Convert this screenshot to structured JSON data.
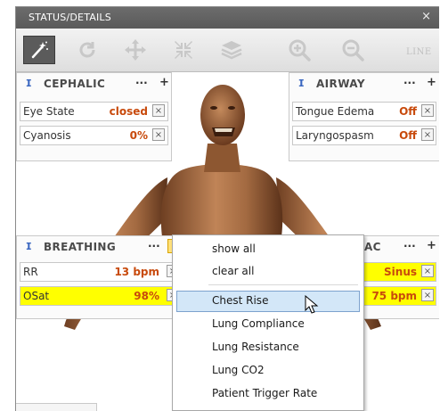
{
  "window": {
    "title": "STATUS/DETAILS",
    "close_glyph": "×"
  },
  "toolbar": {
    "tools": [
      {
        "icon": "magic-wand-icon",
        "active": true
      },
      {
        "icon": "rotate-icon",
        "active": false
      },
      {
        "icon": "move-icon",
        "active": false
      },
      {
        "icon": "collapse-icon",
        "active": false
      },
      {
        "icon": "layers-icon",
        "active": false
      },
      {
        "icon": "zoom-in-icon",
        "active": false
      },
      {
        "icon": "zoom-out-icon",
        "active": false
      }
    ],
    "line_label": "LINE"
  },
  "panels": {
    "cephalic": {
      "title": "CEPHALIC",
      "rows": [
        {
          "label": "Eye State",
          "value": "closed"
        },
        {
          "label": "Cyanosis",
          "value": "0%"
        }
      ]
    },
    "airway": {
      "title": "AIRWAY",
      "rows": [
        {
          "label": "Tongue Edema",
          "value": "Off"
        },
        {
          "label": "Laryngospasm",
          "value": "Off"
        }
      ]
    },
    "breathing": {
      "title": "BREATHING",
      "rows": [
        {
          "label": "RR",
          "value": "13 bpm",
          "highlight": false
        },
        {
          "label": "OSat",
          "value": "98%",
          "highlight": true
        }
      ]
    },
    "cardiac": {
      "title_visible": "AC",
      "rows": [
        {
          "value": "Sinus",
          "highlight": true
        },
        {
          "value": "75 bpm",
          "highlight": true
        }
      ]
    }
  },
  "panel_controls": {
    "more": "···",
    "add": "+",
    "remove": "×",
    "pin": "ⵊ"
  },
  "context_menu": {
    "items": [
      {
        "label": "show all",
        "highlighted": false
      },
      {
        "label": "clear all",
        "highlighted": false
      },
      {
        "label": "Chest Rise",
        "highlighted": true
      },
      {
        "label": "Lung Compliance",
        "highlighted": false
      },
      {
        "label": "Lung Resistance",
        "highlighted": false
      },
      {
        "label": "Lung CO2",
        "highlighted": false
      },
      {
        "label": "Patient Trigger Rate",
        "highlighted": false
      }
    ]
  },
  "colors": {
    "value_text": "#c84a0c",
    "highlight_row": "#ffff00",
    "menu_hover": "#d3e7f8",
    "titlebar": "#5f5f5f"
  }
}
